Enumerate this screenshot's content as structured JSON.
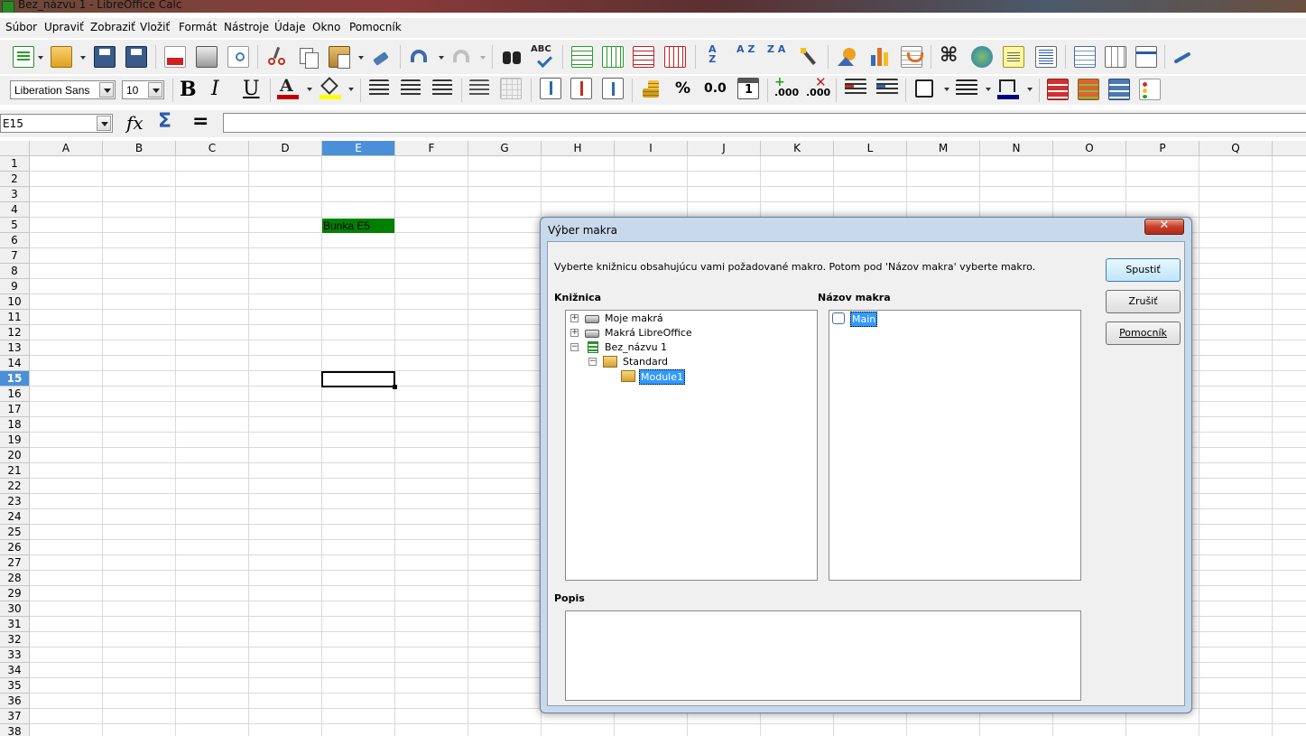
{
  "window": {
    "title": "Bez_názvu 1 - LibreOffice Calc"
  },
  "menu": [
    "Súbor",
    "Upraviť",
    "Zobraziť",
    "Vložiť",
    "Formát",
    "Nástroje",
    "Údaje",
    "Okno",
    "Pomocník"
  ],
  "toolbar": {
    "font_name": "Liberation Sans",
    "font_size": "10",
    "bold_glyph": "B",
    "italic_glyph": "I",
    "underline_glyph": "U",
    "percent_glyph": "%",
    "decimal_glyph": "0.0",
    "add_decimal_glyph": ".000",
    "del_decimal_glyph": ".000",
    "spell_glyph": "ABC",
    "sort_asc_glyph": "A Z",
    "sort_desc_glyph": "Z A",
    "icons": [
      "new-document-icon",
      "open-icon",
      "save-icon",
      "save-as-icon",
      "export-pdf-icon",
      "print-icon",
      "print-preview-icon",
      "cut-icon",
      "copy-icon",
      "paste-icon",
      "clone-format-icon",
      "undo-icon",
      "redo-icon",
      "find-replace-icon",
      "spellcheck-icon",
      "insert-rows-icon",
      "insert-columns-icon",
      "delete-rows-icon",
      "delete-columns-icon",
      "sort-icon",
      "sort-ascending-icon",
      "sort-descending-icon",
      "autofilter-icon",
      "image-icon",
      "chart-icon",
      "pivot-table-icon",
      "special-character-icon",
      "hyperlink-icon",
      "comment-icon",
      "header-footer-icon",
      "define-print-area-icon",
      "freeze-rows-icon",
      "split-window-icon",
      "show-draw-functions-icon"
    ]
  },
  "formula_bar": {
    "name_box": "E15",
    "fx_glyph": "fx",
    "sum_glyph": "Σ",
    "equals_glyph": "=",
    "content": ""
  },
  "sheet": {
    "columns": [
      "A",
      "B",
      "C",
      "D",
      "E",
      "F",
      "G",
      "H",
      "I",
      "J",
      "K",
      "L",
      "M",
      "N",
      "O",
      "P",
      "Q"
    ],
    "rows": [
      "1",
      "2",
      "3",
      "4",
      "5",
      "6",
      "7",
      "8",
      "9",
      "10",
      "11",
      "12",
      "13",
      "14",
      "15",
      "16",
      "17",
      "18",
      "19",
      "20",
      "21",
      "22",
      "23",
      "24",
      "25",
      "26",
      "27",
      "28",
      "29",
      "30",
      "31",
      "32",
      "33",
      "34",
      "35",
      "36",
      "37",
      "38"
    ],
    "selected_column": "E",
    "selected_row": "15",
    "cells": {
      "E5": "Bunka E5"
    },
    "colors": {
      "e5_fill": "#008000",
      "header_selected": "#4a90d9"
    }
  },
  "dialog": {
    "title": "Výber makra",
    "close_glyph": "✕",
    "instruction": "Vyberte knižnicu obsahujúcu vami požadované makro. Potom pod 'Názov makra' vyberte makro.",
    "library_label": "Knižnica",
    "macro_name_label": "Názov makra",
    "description_label": "Popis",
    "tree": [
      {
        "label": "Moje makrá",
        "toggle": "+"
      },
      {
        "label": "Makrá LibreOffice",
        "toggle": "+"
      },
      {
        "label": "Bez_názvu 1",
        "toggle": "−"
      },
      {
        "label": "Standard",
        "toggle": "−"
      },
      {
        "label": "Module1",
        "toggle": ""
      }
    ],
    "macros": [
      "Main"
    ],
    "description": "",
    "buttons": {
      "run": "Spustiť",
      "cancel": "Zrušiť",
      "help": "Pomocník"
    }
  }
}
